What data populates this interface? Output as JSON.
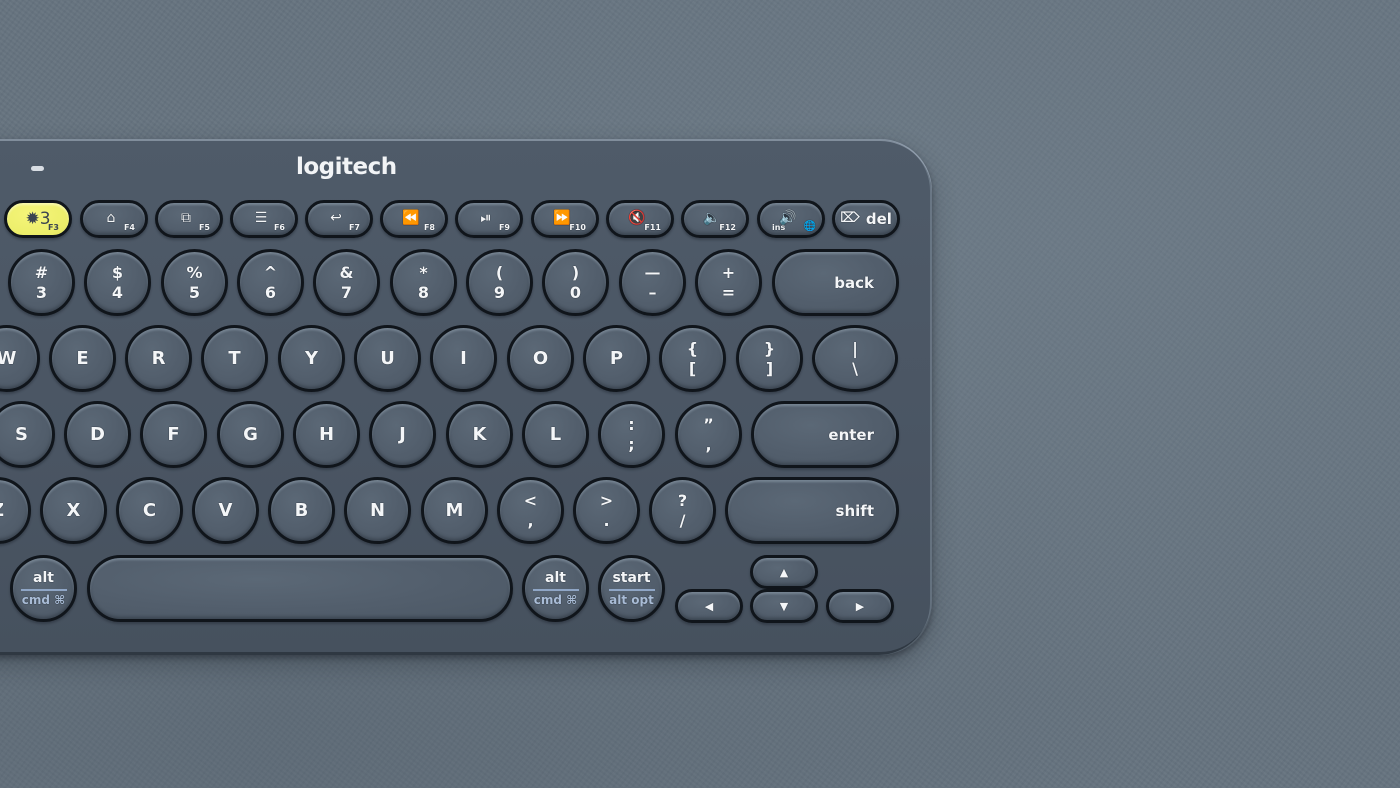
{
  "scene": {
    "description": "Top-down product photo of a Logitech multi-device keyboard on a gray textured surface",
    "colors": {
      "surface": "#66737f",
      "keyboard_body": "#4a5563",
      "key": "#525e6c",
      "key_outline": "#10151b",
      "legend": "#f4f6f8",
      "secondary_legend": "#a9bcd6",
      "easy_switch_key": "#ecee6a"
    }
  },
  "keyboard": {
    "brand": "logitech",
    "status_led": "status-led",
    "function_row": [
      {
        "id": "easy-switch-3",
        "main": "✹3",
        "icon": "bluetooth-icon",
        "fn": "F3",
        "highlighted": true
      },
      {
        "id": "home",
        "icon_glyph": "⌂",
        "icon": "home-icon",
        "fn": "F4"
      },
      {
        "id": "app-switch",
        "icon_glyph": "⧉",
        "icon": "app-switch-icon",
        "fn": "F5"
      },
      {
        "id": "menu",
        "icon_glyph": "☰",
        "icon": "context-menu-icon",
        "fn": "F6"
      },
      {
        "id": "back",
        "icon_glyph": "↩",
        "icon": "back-arrow-icon",
        "fn": "F7"
      },
      {
        "id": "rewind",
        "icon_glyph": "⏪",
        "icon": "rewind-icon",
        "fn": "F8"
      },
      {
        "id": "play-pause",
        "icon_glyph": "⏯",
        "icon": "play-pause-icon",
        "fn": "F9"
      },
      {
        "id": "fast-forward",
        "icon_glyph": "⏩",
        "icon": "fast-forward-icon",
        "fn": "F10"
      },
      {
        "id": "mute",
        "icon_glyph": "🔇",
        "icon": "mute-icon",
        "fn": "F11"
      },
      {
        "id": "volume-down",
        "icon_glyph": "🔈",
        "icon": "volume-down-icon",
        "fn": "F12"
      },
      {
        "id": "volume-up",
        "icon_glyph": "🔊",
        "icon": "volume-up-icon",
        "sub": "ins",
        "globe": "🌐"
      },
      {
        "id": "delete",
        "icon_glyph": "⌦",
        "icon": "delete-icon",
        "label": "del"
      }
    ],
    "number_row": [
      {
        "top": "#",
        "bottom": "3"
      },
      {
        "top": "$",
        "bottom": "4"
      },
      {
        "top": "%",
        "bottom": "5"
      },
      {
        "top": "^",
        "bottom": "6"
      },
      {
        "top": "&",
        "bottom": "7"
      },
      {
        "top": "*",
        "bottom": "8"
      },
      {
        "top": "(",
        "bottom": "9"
      },
      {
        "top": ")",
        "bottom": "0"
      },
      {
        "top": "—",
        "bottom": "–"
      },
      {
        "top": "+",
        "bottom": "="
      }
    ],
    "back_label": "back",
    "qwerty_row": [
      "W",
      "E",
      "R",
      "T",
      "Y",
      "U",
      "I",
      "O",
      "P"
    ],
    "bracket_keys": [
      {
        "top": "{",
        "bottom": "["
      },
      {
        "top": "}",
        "bottom": "]"
      },
      {
        "top": "|",
        "bottom": "\\"
      }
    ],
    "home_row": [
      "S",
      "D",
      "F",
      "G",
      "H",
      "J",
      "K",
      "L"
    ],
    "home_punct": [
      {
        "top": ":",
        "bottom": ";"
      },
      {
        "top": "”",
        "bottom": ","
      }
    ],
    "enter_label": "enter",
    "bottom_alpha_row": [
      "Z",
      "X",
      "C",
      "V",
      "B",
      "N",
      "M"
    ],
    "bottom_punct": [
      {
        "top": "<",
        "bottom": ","
      },
      {
        "top": ">",
        "bottom": "."
      },
      {
        "top": "?",
        "bottom": "/"
      }
    ],
    "shift_label": "shift",
    "modifier_keys": [
      {
        "id": "alt-left",
        "top": "alt",
        "bottom": "cmd ⌘"
      },
      {
        "id": "alt-right",
        "top": "alt",
        "bottom": "cmd ⌘"
      },
      {
        "id": "start",
        "top": "start",
        "bottom": "alt opt"
      }
    ],
    "arrows": {
      "up": "▲",
      "down": "▼",
      "left": "◀",
      "right": "▶"
    }
  }
}
